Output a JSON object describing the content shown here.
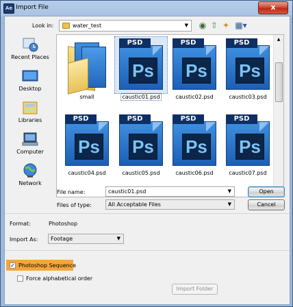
{
  "window": {
    "app_icon": "Ae",
    "title": "Import File",
    "close_glyph": "x"
  },
  "lookin": {
    "label": "Look in:",
    "value": "water_test"
  },
  "places": [
    {
      "label": "Recent Places",
      "icon": "recent-places-icon"
    },
    {
      "label": "Desktop",
      "icon": "desktop-icon"
    },
    {
      "label": "Libraries",
      "icon": "libraries-icon"
    },
    {
      "label": "Computer",
      "icon": "computer-icon"
    },
    {
      "label": "Network",
      "icon": "network-icon"
    }
  ],
  "files": [
    {
      "name": "small",
      "type": "folder"
    },
    {
      "name": "caustic01.psd",
      "type": "psd",
      "selected": true
    },
    {
      "name": "caustic02.psd",
      "type": "psd"
    },
    {
      "name": "caustic03.psd",
      "type": "psd"
    },
    {
      "name": "caustic04.psd",
      "type": "psd"
    },
    {
      "name": "caustic05.psd",
      "type": "psd"
    },
    {
      "name": "caustic06.psd",
      "type": "psd"
    },
    {
      "name": "caustic07.psd",
      "type": "psd"
    }
  ],
  "psd_badge": "PSD",
  "psd_mark": "Ps",
  "filename": {
    "label": "File name:",
    "value": "caustic01.psd"
  },
  "filetype": {
    "label": "Files of type:",
    "value": "All Acceptable Files"
  },
  "buttons": {
    "open": "Open",
    "cancel": "Cancel",
    "import_folder": "Import Folder"
  },
  "format": {
    "label": "Format:",
    "value": "Photoshop"
  },
  "import_as": {
    "label": "Import As:",
    "value": "Footage"
  },
  "options": {
    "sequence": {
      "label": "Photoshop Sequence",
      "checked": true
    },
    "alphabetical": {
      "label": "Force alphabetical order",
      "checked": false
    }
  },
  "colors": {
    "highlight": "#f6a63d",
    "title_bar": "#b7cde8",
    "psd_blue": "#1c5fb6"
  }
}
